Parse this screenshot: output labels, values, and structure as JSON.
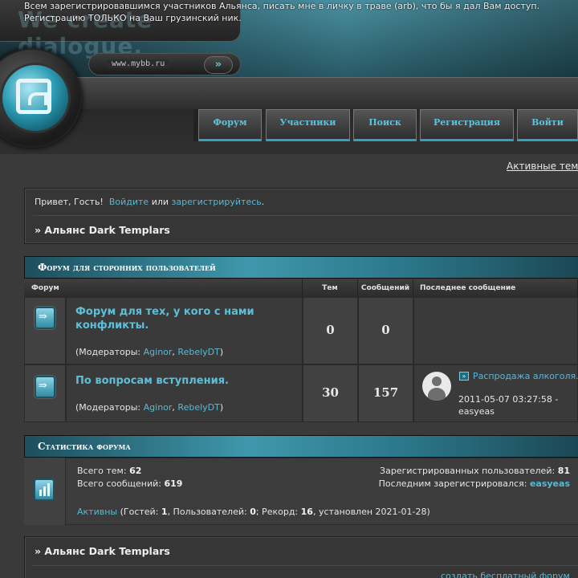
{
  "header": {
    "notice": "Всем зарегистрировавшимся участников Альянса, писать мне в личку в траве (arb), что бы я дал Вам доступ. Регистрацию ТОЛЬКО на Ваш грузинский ник.",
    "logo_text": "We create dialogue.",
    "url_text": "www.mybb.ru",
    "go_label": "»",
    "nav": [
      "Форум",
      "Участники",
      "Поиск",
      "Регистрация",
      "Войти"
    ]
  },
  "active_topics": "Активные темы",
  "welcome": {
    "greeting": "Привет, Гость!",
    "login_link": "Войдите",
    "or_text": "или",
    "register_link": "зарегистрируйтесь",
    "period": ".",
    "crumb": "» Альянс Dark Templars"
  },
  "category": {
    "title": "Форум для сторонних пользователей",
    "columns": {
      "forum": "Форум",
      "topics": "Тем",
      "posts": "Сообщений",
      "last": "Последнее сообщение"
    },
    "forums": [
      {
        "title": "Форум для тех, у кого с нами конфликты.",
        "moderators_label": "(Модераторы:",
        "moderators": [
          "Aginor",
          "RebelyDT"
        ],
        "close": ")",
        "topics": "0",
        "posts": "0"
      },
      {
        "title": "По вопросам вступления.",
        "moderators_label": "(Модераторы:",
        "moderators": [
          "Aginor",
          "RebelyDT"
        ],
        "close": ")",
        "topics": "30",
        "posts": "157",
        "last_post": {
          "icon": "»",
          "title": "Распродажа алкоголя.",
          "date": "2011-05-07 03:27:58 -",
          "author": "easyeas"
        }
      }
    ]
  },
  "stats": {
    "title": "Статистика форума",
    "total_topics_label": "Всего тем:",
    "total_topics": "62",
    "total_posts_label": "Всего сообщений:",
    "total_posts": "619",
    "registered_label": "Зарегистрированных пользователей:",
    "registered": "81",
    "last_registered_label": "Последним зарегистрировался:",
    "last_registered": "easyeas",
    "active_link": "Активны",
    "guests_label": "(Гостей:",
    "guests": "1",
    "users_label": ", Пользователей:",
    "users": "0",
    "record_label": "; Рекорд:",
    "record": "16",
    "record_date_label": ", установлен 2021-01-28)"
  },
  "footer": {
    "crumb": "» Альянс Dark Templars",
    "create_link": "создать бесплатный форум"
  }
}
